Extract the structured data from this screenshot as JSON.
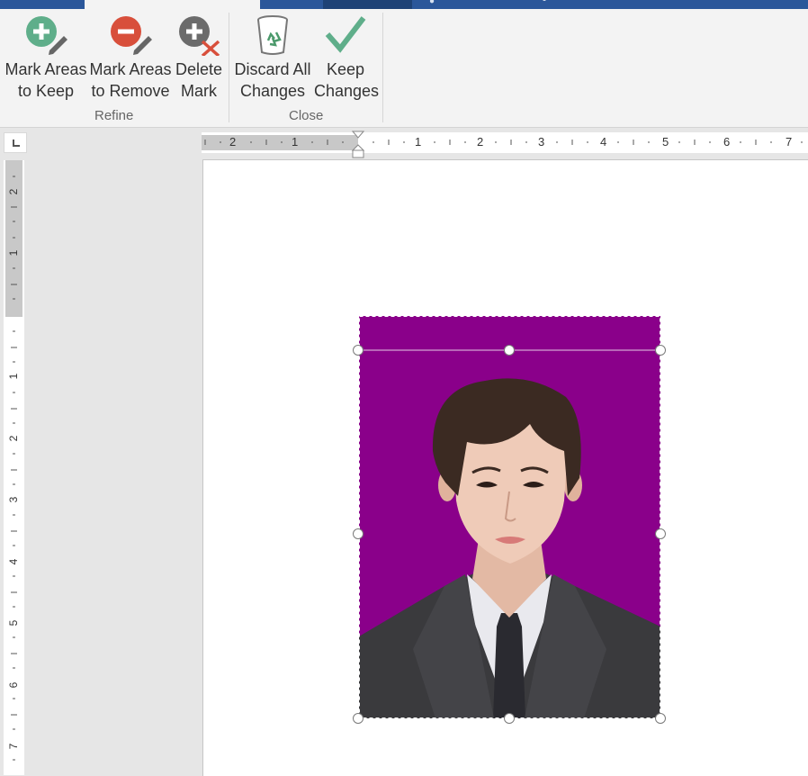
{
  "ribbon": {
    "groups": [
      {
        "label": "Refine",
        "buttons": [
          {
            "line1": "Mark Areas",
            "line2": "to Keep",
            "icon": "plus-pencil-icon"
          },
          {
            "line1": "Mark Areas",
            "line2": "to Remove",
            "icon": "minus-pencil-icon"
          },
          {
            "line1": "Delete",
            "line2": "Mark",
            "icon": "plus-x-icon"
          }
        ]
      },
      {
        "label": "Close",
        "buttons": [
          {
            "line1": "Discard All",
            "line2": "Changes",
            "icon": "recycle-bin-icon"
          },
          {
            "line1": "Keep",
            "line2": "Changes",
            "icon": "checkmark-icon"
          }
        ]
      }
    ]
  },
  "ruler": {
    "horizontal_numbers": [
      "2",
      "1",
      "1",
      "2",
      "3",
      "4",
      "5",
      "6",
      "7"
    ],
    "vertical_numbers": [
      "2",
      "1",
      "1",
      "2",
      "3",
      "4",
      "5",
      "6",
      "7"
    ]
  },
  "colors": {
    "accent": "#2b579a",
    "photo_background": "#8a008a",
    "keep_icon": "#5fae8a",
    "remove_icon": "#d84f3b"
  }
}
